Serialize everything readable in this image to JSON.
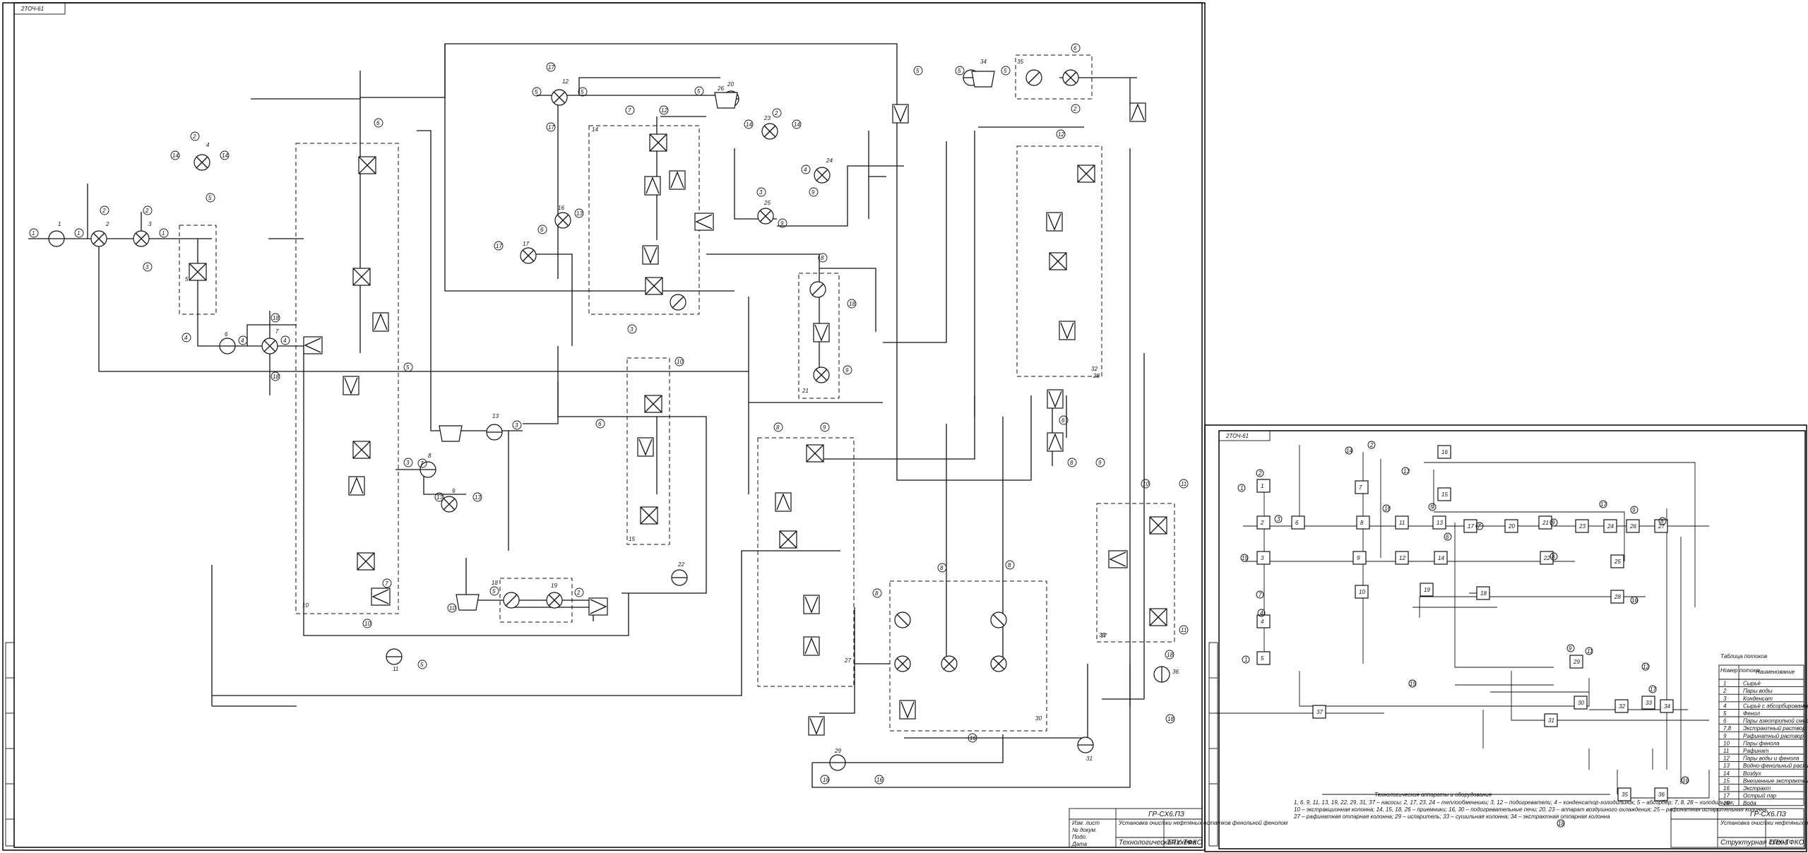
{
  "sheet1": {
    "stamp": "2ТОЧ-61",
    "title_code": "ГР-СХ6.ПЗ",
    "description": "Установка очистки нефтяных остатков фенольной фенолом",
    "drawing_name": "Технологическая схема",
    "org": "ТПУ-ТФКО",
    "side_labels": [
      "Изм. лист",
      "№ докум.",
      "Подп.",
      "Дата"
    ]
  },
  "sheet2": {
    "stamp": "2ТОЧ-61",
    "title_code": "ГР-СХ6.ПЗ",
    "description": "Установка очистки нефтяных остатков фенольной фенолом",
    "drawing_name": "Структурная схема",
    "org": "ТПУ-ТФКО",
    "legend_title": "Технологические аппараты и оборудование",
    "legend_lines": [
      "1, 6, 9, 11, 13, 19, 22, 29, 31, 37 – насосы; 2, 17, 23, 24 – теплообменники; 3, 12 – подогреватели; 4 – конденсатор-холодильник; 5 – абсорбер; 7, 8, 28 – холодильник;",
      "10 – экстракционная колонна; 14, 15, 18, 26 – приемники; 16, 30 – подогревательные печи; 20, 23 – аппарат воздушного охлаждения; 25 – рафинатная испарительная колонна;",
      "27 – рафинатная отпарная колонна; 29 – испаритель; 33 – сушильная колонна; 34 – экстрактная отпарная колонна"
    ],
    "flow_table_title": "Таблица потоков",
    "flow_table_header": [
      "Номер потока",
      "Наименование"
    ],
    "flow_table": [
      [
        "1",
        "Сырьё"
      ],
      [
        "2",
        "Пары воды"
      ],
      [
        "3",
        "Конденсат"
      ],
      [
        "4",
        "Сырьё с абсорбированным фенолом"
      ],
      [
        "5",
        "Фенол"
      ],
      [
        "6",
        "Пары азеотропной смеси"
      ],
      [
        "7,8",
        "Экстрактный раствор"
      ],
      [
        "9",
        "Рафинатный раствор"
      ],
      [
        "10",
        "Пары фенола"
      ],
      [
        "11",
        "Рафинат"
      ],
      [
        "12",
        "Пары воды и фенола"
      ],
      [
        "13",
        "Водно-фенольный раствор"
      ],
      [
        "14",
        "Воздух"
      ],
      [
        "15",
        "Внешенные экстрактные раствор"
      ],
      [
        "16",
        "Экстракт"
      ],
      [
        "17",
        "Острый пар"
      ],
      [
        "18",
        "Вода"
      ]
    ]
  },
  "sheet1_units": [
    "1",
    "2",
    "3",
    "4",
    "5",
    "6",
    "7",
    "8",
    "9",
    "10",
    "11",
    "12",
    "13",
    "14",
    "15",
    "16",
    "17",
    "18",
    "19",
    "20",
    "21",
    "22",
    "23",
    "24",
    "25",
    "26",
    "27",
    "28",
    "29",
    "30",
    "31",
    "32",
    "33",
    "34",
    "35",
    "36",
    "37"
  ],
  "sheet2_units": [
    "1",
    "2",
    "3",
    "4",
    "5",
    "6",
    "7",
    "8",
    "9",
    "10",
    "11",
    "12",
    "13",
    "14",
    "15",
    "16",
    "17",
    "18",
    "19",
    "20",
    "21",
    "22",
    "23",
    "24",
    "25",
    "26",
    "27",
    "28",
    "29",
    "30",
    "31",
    "32",
    "33",
    "34",
    "35",
    "36",
    "37"
  ],
  "stream_markers": [
    "1",
    "2",
    "3",
    "4",
    "5",
    "6",
    "7",
    "8",
    "9",
    "10",
    "11",
    "12",
    "13",
    "14",
    "15",
    "16",
    "17",
    "18"
  ]
}
